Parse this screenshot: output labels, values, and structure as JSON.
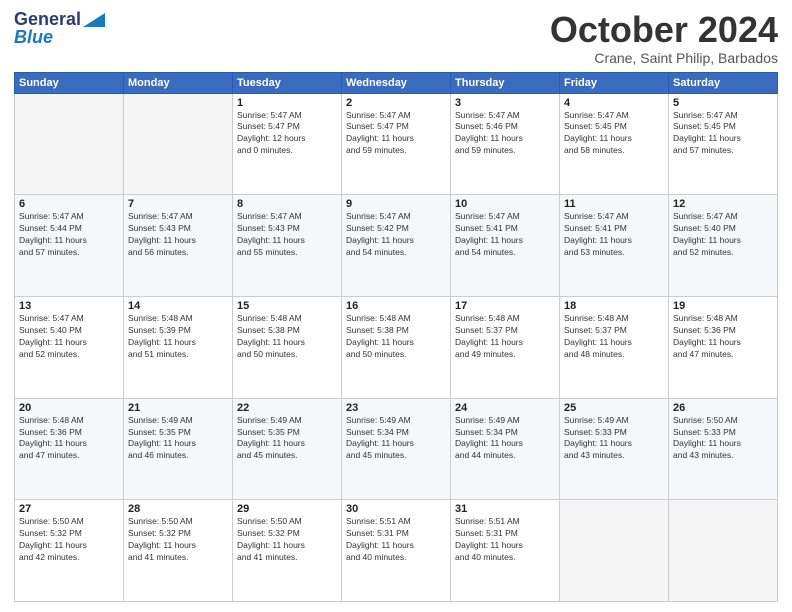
{
  "header": {
    "logo_line1": "General",
    "logo_line2": "Blue",
    "month": "October 2024",
    "location": "Crane, Saint Philip, Barbados"
  },
  "days_of_week": [
    "Sunday",
    "Monday",
    "Tuesday",
    "Wednesday",
    "Thursday",
    "Friday",
    "Saturday"
  ],
  "weeks": [
    [
      {
        "day": "",
        "info": ""
      },
      {
        "day": "",
        "info": ""
      },
      {
        "day": "1",
        "info": "Sunrise: 5:47 AM\nSunset: 5:47 PM\nDaylight: 12 hours\nand 0 minutes."
      },
      {
        "day": "2",
        "info": "Sunrise: 5:47 AM\nSunset: 5:47 PM\nDaylight: 11 hours\nand 59 minutes."
      },
      {
        "day": "3",
        "info": "Sunrise: 5:47 AM\nSunset: 5:46 PM\nDaylight: 11 hours\nand 59 minutes."
      },
      {
        "day": "4",
        "info": "Sunrise: 5:47 AM\nSunset: 5:45 PM\nDaylight: 11 hours\nand 58 minutes."
      },
      {
        "day": "5",
        "info": "Sunrise: 5:47 AM\nSunset: 5:45 PM\nDaylight: 11 hours\nand 57 minutes."
      }
    ],
    [
      {
        "day": "6",
        "info": "Sunrise: 5:47 AM\nSunset: 5:44 PM\nDaylight: 11 hours\nand 57 minutes."
      },
      {
        "day": "7",
        "info": "Sunrise: 5:47 AM\nSunset: 5:43 PM\nDaylight: 11 hours\nand 56 minutes."
      },
      {
        "day": "8",
        "info": "Sunrise: 5:47 AM\nSunset: 5:43 PM\nDaylight: 11 hours\nand 55 minutes."
      },
      {
        "day": "9",
        "info": "Sunrise: 5:47 AM\nSunset: 5:42 PM\nDaylight: 11 hours\nand 54 minutes."
      },
      {
        "day": "10",
        "info": "Sunrise: 5:47 AM\nSunset: 5:41 PM\nDaylight: 11 hours\nand 54 minutes."
      },
      {
        "day": "11",
        "info": "Sunrise: 5:47 AM\nSunset: 5:41 PM\nDaylight: 11 hours\nand 53 minutes."
      },
      {
        "day": "12",
        "info": "Sunrise: 5:47 AM\nSunset: 5:40 PM\nDaylight: 11 hours\nand 52 minutes."
      }
    ],
    [
      {
        "day": "13",
        "info": "Sunrise: 5:47 AM\nSunset: 5:40 PM\nDaylight: 11 hours\nand 52 minutes."
      },
      {
        "day": "14",
        "info": "Sunrise: 5:48 AM\nSunset: 5:39 PM\nDaylight: 11 hours\nand 51 minutes."
      },
      {
        "day": "15",
        "info": "Sunrise: 5:48 AM\nSunset: 5:38 PM\nDaylight: 11 hours\nand 50 minutes."
      },
      {
        "day": "16",
        "info": "Sunrise: 5:48 AM\nSunset: 5:38 PM\nDaylight: 11 hours\nand 50 minutes."
      },
      {
        "day": "17",
        "info": "Sunrise: 5:48 AM\nSunset: 5:37 PM\nDaylight: 11 hours\nand 49 minutes."
      },
      {
        "day": "18",
        "info": "Sunrise: 5:48 AM\nSunset: 5:37 PM\nDaylight: 11 hours\nand 48 minutes."
      },
      {
        "day": "19",
        "info": "Sunrise: 5:48 AM\nSunset: 5:36 PM\nDaylight: 11 hours\nand 47 minutes."
      }
    ],
    [
      {
        "day": "20",
        "info": "Sunrise: 5:48 AM\nSunset: 5:36 PM\nDaylight: 11 hours\nand 47 minutes."
      },
      {
        "day": "21",
        "info": "Sunrise: 5:49 AM\nSunset: 5:35 PM\nDaylight: 11 hours\nand 46 minutes."
      },
      {
        "day": "22",
        "info": "Sunrise: 5:49 AM\nSunset: 5:35 PM\nDaylight: 11 hours\nand 45 minutes."
      },
      {
        "day": "23",
        "info": "Sunrise: 5:49 AM\nSunset: 5:34 PM\nDaylight: 11 hours\nand 45 minutes."
      },
      {
        "day": "24",
        "info": "Sunrise: 5:49 AM\nSunset: 5:34 PM\nDaylight: 11 hours\nand 44 minutes."
      },
      {
        "day": "25",
        "info": "Sunrise: 5:49 AM\nSunset: 5:33 PM\nDaylight: 11 hours\nand 43 minutes."
      },
      {
        "day": "26",
        "info": "Sunrise: 5:50 AM\nSunset: 5:33 PM\nDaylight: 11 hours\nand 43 minutes."
      }
    ],
    [
      {
        "day": "27",
        "info": "Sunrise: 5:50 AM\nSunset: 5:32 PM\nDaylight: 11 hours\nand 42 minutes."
      },
      {
        "day": "28",
        "info": "Sunrise: 5:50 AM\nSunset: 5:32 PM\nDaylight: 11 hours\nand 41 minutes."
      },
      {
        "day": "29",
        "info": "Sunrise: 5:50 AM\nSunset: 5:32 PM\nDaylight: 11 hours\nand 41 minutes."
      },
      {
        "day": "30",
        "info": "Sunrise: 5:51 AM\nSunset: 5:31 PM\nDaylight: 11 hours\nand 40 minutes."
      },
      {
        "day": "31",
        "info": "Sunrise: 5:51 AM\nSunset: 5:31 PM\nDaylight: 11 hours\nand 40 minutes."
      },
      {
        "day": "",
        "info": ""
      },
      {
        "day": "",
        "info": ""
      }
    ]
  ]
}
